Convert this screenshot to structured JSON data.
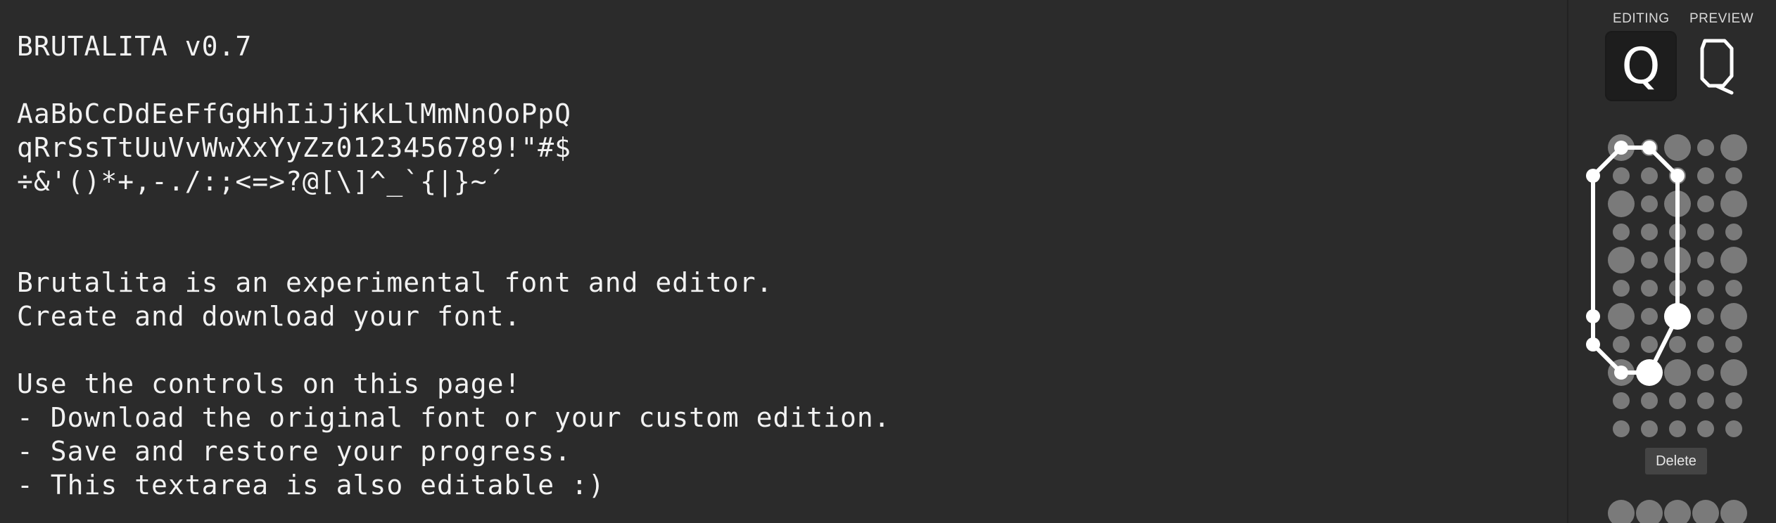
{
  "editor": {
    "text": "BRUTALITA v0.7\n\nAaBbCcDdEeFfGgHhIiJjKkLlMmNnOoPpQ\nqRrSsTtUuVvWwXxYyZz0123456789!\"#$\n÷&'()*+,-./:;<=>?@[\\]^_`{|}~´\n\n\nBrutalita is an experimental font and editor.\nCreate and download your font.\n\nUse the controls on this page!\n- Download the original font or your custom edition.\n- Save and restore your progress.\n- This textarea is also editable :)"
  },
  "panel": {
    "editing_label": "EDITING",
    "preview_label": "PREVIEW",
    "editing_glyph": "Q",
    "delete_label": "Delete"
  },
  "colors": {
    "background": "#2b2b2b",
    "text": "#f2f2f2",
    "dot_inactive": "#7a7a7a",
    "dot_active": "#ffffff",
    "stroke": "#ffffff",
    "button_bg": "#444444"
  }
}
